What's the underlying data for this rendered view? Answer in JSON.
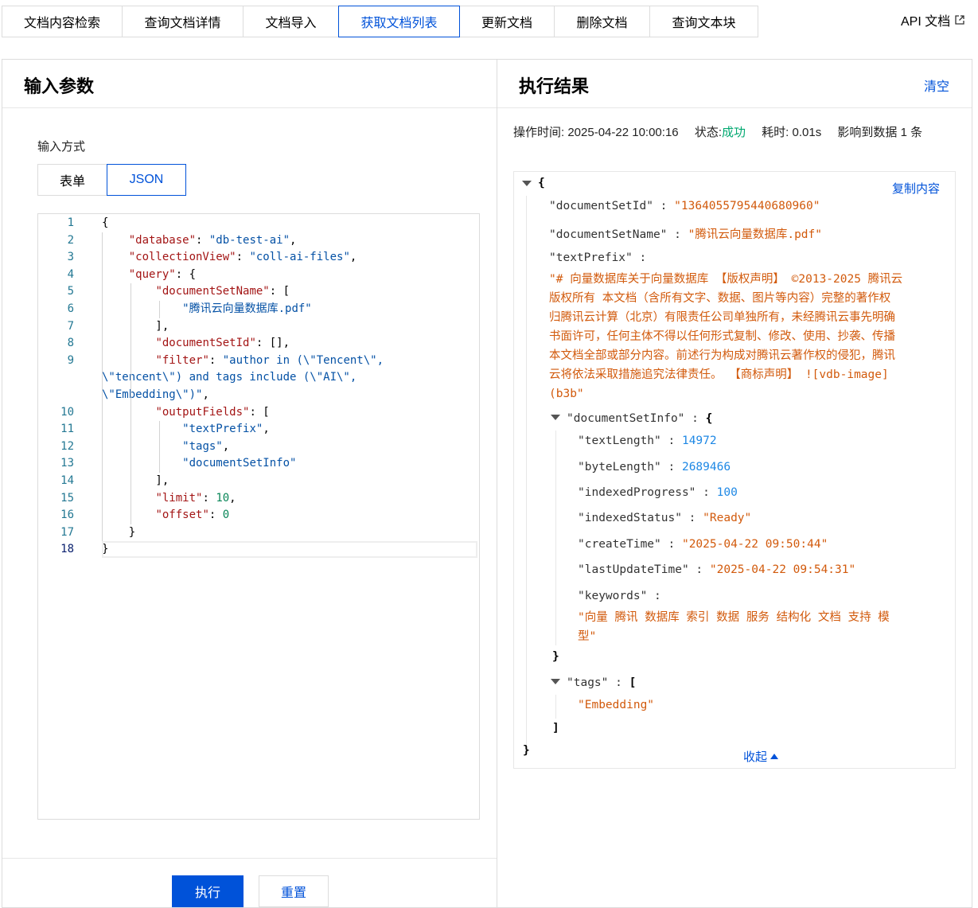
{
  "tabs": [
    {
      "label": "文档内容检索",
      "active": false
    },
    {
      "label": "查询文档详情",
      "active": false
    },
    {
      "label": "文档导入",
      "active": false
    },
    {
      "label": "获取文档列表",
      "active": true
    },
    {
      "label": "更新文档",
      "active": false
    },
    {
      "label": "删除文档",
      "active": false
    },
    {
      "label": "查询文本块",
      "active": false
    }
  ],
  "api_doc_link": "API 文档",
  "input_panel": {
    "title": "输入参数",
    "input_mode_label": "输入方式",
    "modes": [
      "表单",
      "JSON"
    ],
    "active_mode": "JSON",
    "editor": {
      "current_line": "18",
      "lines": [
        {
          "n": "1",
          "parts": [
            [
              "p",
              "{"
            ]
          ]
        },
        {
          "n": "2",
          "parts": [
            [
              "p",
              "    "
            ],
            [
              "k",
              "\"database\""
            ],
            [
              "p",
              ": "
            ],
            [
              "s",
              "\"db-test-ai\""
            ],
            [
              "p",
              ","
            ]
          ]
        },
        {
          "n": "3",
          "parts": [
            [
              "p",
              "    "
            ],
            [
              "k",
              "\"collectionView\""
            ],
            [
              "p",
              ": "
            ],
            [
              "s",
              "\"coll-ai-files\""
            ],
            [
              "p",
              ","
            ]
          ]
        },
        {
          "n": "4",
          "parts": [
            [
              "p",
              "    "
            ],
            [
              "k",
              "\"query\""
            ],
            [
              "p",
              ": {"
            ]
          ]
        },
        {
          "n": "5",
          "parts": [
            [
              "p",
              "        "
            ],
            [
              "k",
              "\"documentSetName\""
            ],
            [
              "p",
              ": ["
            ]
          ]
        },
        {
          "n": "6",
          "parts": [
            [
              "p",
              "            "
            ],
            [
              "s",
              "\"腾讯云向量数据库.pdf\""
            ]
          ]
        },
        {
          "n": "7",
          "parts": [
            [
              "p",
              "        ],"
            ]
          ]
        },
        {
          "n": "8",
          "parts": [
            [
              "p",
              "        "
            ],
            [
              "k",
              "\"documentSetId\""
            ],
            [
              "p",
              ": [],"
            ]
          ]
        },
        {
          "n": "9",
          "parts": [
            [
              "p",
              "        "
            ],
            [
              "k",
              "\"filter\""
            ],
            [
              "p",
              ": "
            ],
            [
              "s",
              "\"author in (\\\"Tencent\\\","
            ]
          ]
        },
        {
          "n": "",
          "parts": [
            [
              "s",
              "\\\"tencent\\\") and tags include (\\\"AI\\\","
            ]
          ]
        },
        {
          "n": "",
          "parts": [
            [
              "s",
              "\\\"Embedding\\\")\""
            ],
            [
              "p",
              ","
            ]
          ]
        },
        {
          "n": "10",
          "parts": [
            [
              "p",
              "        "
            ],
            [
              "k",
              "\"outputFields\""
            ],
            [
              "p",
              ": ["
            ]
          ]
        },
        {
          "n": "11",
          "parts": [
            [
              "p",
              "            "
            ],
            [
              "s",
              "\"textPrefix\""
            ],
            [
              "p",
              ","
            ]
          ]
        },
        {
          "n": "12",
          "parts": [
            [
              "p",
              "            "
            ],
            [
              "s",
              "\"tags\""
            ],
            [
              "p",
              ","
            ]
          ]
        },
        {
          "n": "13",
          "parts": [
            [
              "p",
              "            "
            ],
            [
              "s",
              "\"documentSetInfo\""
            ]
          ]
        },
        {
          "n": "14",
          "parts": [
            [
              "p",
              "        ],"
            ]
          ]
        },
        {
          "n": "15",
          "parts": [
            [
              "p",
              "        "
            ],
            [
              "k",
              "\"limit\""
            ],
            [
              "p",
              ": "
            ],
            [
              "num",
              "10"
            ],
            [
              "p",
              ","
            ]
          ]
        },
        {
          "n": "16",
          "parts": [
            [
              "p",
              "        "
            ],
            [
              "k",
              "\"offset\""
            ],
            [
              "p",
              ": "
            ],
            [
              "num",
              "0"
            ]
          ]
        },
        {
          "n": "17",
          "parts": [
            [
              "p",
              "    }"
            ]
          ]
        },
        {
          "n": "18",
          "parts": [
            [
              "p",
              "}"
            ]
          ]
        }
      ]
    },
    "execute_label": "执行",
    "reset_label": "重置"
  },
  "result_panel": {
    "title": "执行结果",
    "clear_label": "清空",
    "meta": {
      "time_label": "操作时间:",
      "time_value": "2025-04-22 10:00:16",
      "status_label": "状态:",
      "status_value": "成功",
      "cost_label": "耗时:",
      "cost_value": "0.01s",
      "affected_label": "影响到数据",
      "affected_value": "1",
      "affected_unit": "条"
    },
    "copy_label": "复制内容",
    "collapse_label": "收起",
    "json": {
      "open_brace": "{",
      "close_brace": "}",
      "documentSetId_key": "\"documentSetId\"",
      "documentSetId_val": "\"1364055795440680960\"",
      "documentSetName_key": "\"documentSetName\"",
      "documentSetName_val": "\"腾讯云向量数据库.pdf\"",
      "textPrefix_key": "\"textPrefix\"",
      "textPrefix_val_lines": [
        "\"# 向量数据库关于向量数据库 【版权声明】 ©2013-2025 腾讯云",
        "版权所有 本文档（含所有文字、数据、图片等内容）完整的著作权",
        "归腾讯云计算（北京）有限责任公司单独所有，未经腾讯云事先明确",
        "书面许可，任何主体不得以任何形式复制、修改、使用、抄袭、传播",
        "本文档全部或部分内容。前述行为构成对腾讯云著作权的侵犯，腾讯",
        "云将依法采取措施追究法律责任。 【商标声明】 ![vdb-image]",
        "(b3b\""
      ],
      "documentSetInfo_key": "\"documentSetInfo\"",
      "textLength_key": "\"textLength\"",
      "textLength_val": "14972",
      "byteLength_key": "\"byteLength\"",
      "byteLength_val": "2689466",
      "indexedProgress_key": "\"indexedProgress\"",
      "indexedProgress_val": "100",
      "indexedStatus_key": "\"indexedStatus\"",
      "indexedStatus_val": "\"Ready\"",
      "createTime_key": "\"createTime\"",
      "createTime_val": "\"2025-04-22 09:50:44\"",
      "lastUpdateTime_key": "\"lastUpdateTime\"",
      "lastUpdateTime_val": "\"2025-04-22 09:54:31\"",
      "keywords_key": "\"keywords\"",
      "keywords_val_lines": [
        "\"向量 腾讯 数据库 索引 数据 服务 结构化 文档 支持 模",
        "型\""
      ],
      "tags_key": "\"tags\"",
      "tags_item": "\"Embedding\""
    }
  }
}
